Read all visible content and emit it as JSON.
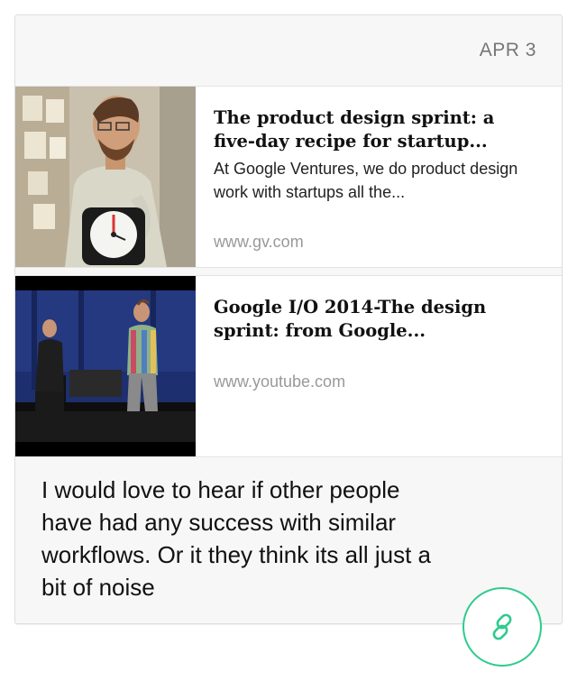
{
  "post": {
    "date": "APR 3",
    "comment": "I would love to hear if other people have had any success with similar workflows. Or it they think its all just a bit of noise"
  },
  "links": [
    {
      "title": "The product design sprint: a five-day recipe for startup...",
      "description": "At Google Ventures, we do product design work with startups all the...",
      "domain": "www.gv.com"
    },
    {
      "title": "Google I/O 2014-The design sprint: from Google...",
      "description": "",
      "domain": "www.youtube.com"
    }
  ],
  "colors": {
    "accent": "#2ecb8d",
    "card_bg": "#f7f7f7",
    "domain_text": "#999999"
  },
  "icons": {
    "link_button": "chain-link-icon"
  }
}
